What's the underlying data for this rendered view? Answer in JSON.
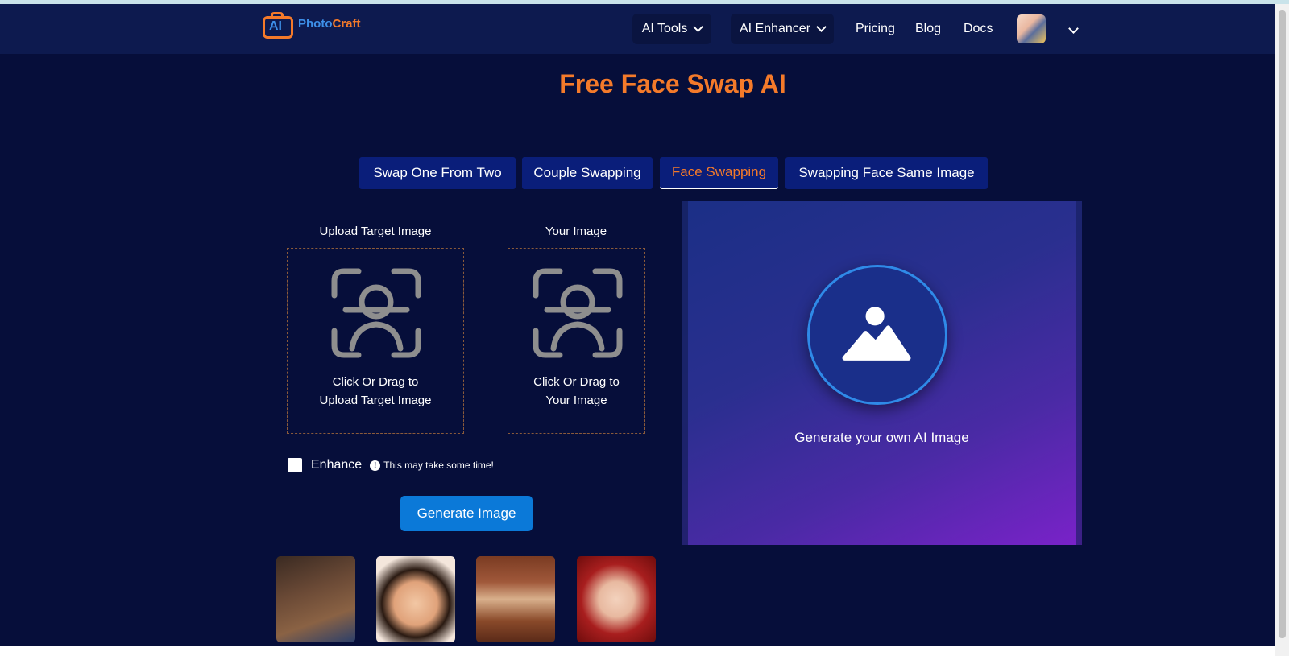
{
  "brand": {
    "logo_mark": "AI",
    "name_part1": "Photo",
    "name_part2": "Craft"
  },
  "nav": {
    "ai_tools": "AI Tools",
    "ai_enhancer": "AI Enhancer",
    "pricing": "Pricing",
    "blog": "Blog",
    "docs": "Docs"
  },
  "page": {
    "title": "Free Face Swap AI"
  },
  "tabs": [
    {
      "label": "Swap One From Two",
      "active": false
    },
    {
      "label": "Couple Swapping",
      "active": false
    },
    {
      "label": "Face Swapping",
      "active": true
    },
    {
      "label": "Swapping Face Same Image",
      "active": false
    }
  ],
  "upload": {
    "target_label": "Upload Target Image",
    "target_hint_line1": "Click Or Drag to",
    "target_hint_line2": "Upload Target Image",
    "your_label": "Your Image",
    "your_hint_line1": "Click Or Drag to",
    "your_hint_line2": "Your Image"
  },
  "enhance": {
    "label": "Enhance",
    "checked": false,
    "info_glyph": "!",
    "note": "This may take some time!"
  },
  "actions": {
    "generate": "Generate Image"
  },
  "preview": {
    "caption": "Generate your own AI Image",
    "icon": "image-icon"
  },
  "colors": {
    "background": "#060e3a",
    "navbar": "#0d1a4f",
    "accent_orange": "#f47a2a",
    "tab_bg": "#0a1e7a",
    "button_blue": "#0b79d8"
  }
}
